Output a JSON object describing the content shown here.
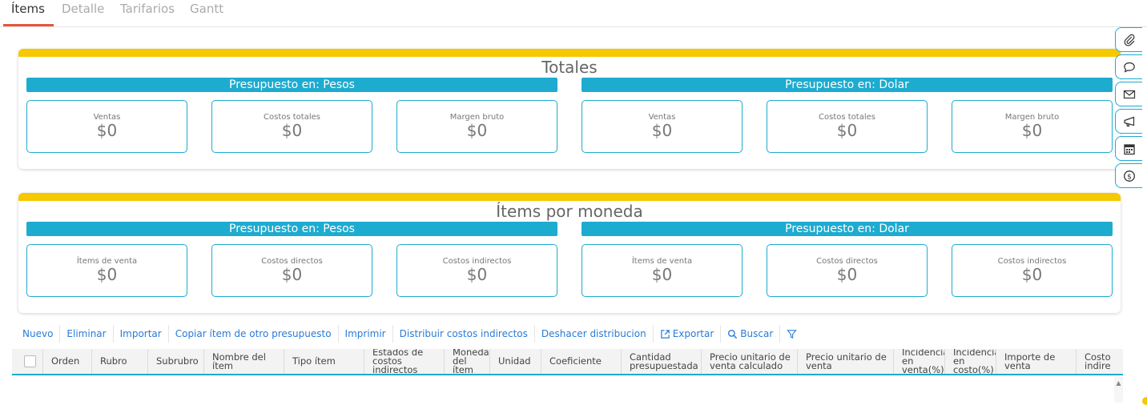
{
  "tabs": [
    "Ítems",
    "Detalle",
    "Tarifarios",
    "Gantt"
  ],
  "totales": {
    "title": "Totales",
    "groups": [
      {
        "header": "Presupuesto en: Pesos",
        "cards": [
          {
            "label": "Ventas",
            "value": "$0"
          },
          {
            "label": "Costos totales",
            "value": "$0"
          },
          {
            "label": "Margen bruto",
            "value": "$0"
          }
        ]
      },
      {
        "header": "Presupuesto en: Dolar",
        "cards": [
          {
            "label": "Ventas",
            "value": "$0"
          },
          {
            "label": "Costos totales",
            "value": "$0"
          },
          {
            "label": "Margen bruto",
            "value": "$0"
          }
        ]
      }
    ]
  },
  "items_por_moneda": {
    "title": "Ítems por moneda",
    "groups": [
      {
        "header": "Presupuesto en: Pesos",
        "cards": [
          {
            "label": "Ítems de venta",
            "value": "$0"
          },
          {
            "label": "Costos directos",
            "value": "$0"
          },
          {
            "label": "Costos indirectos",
            "value": "$0"
          }
        ]
      },
      {
        "header": "Presupuesto en: Dolar",
        "cards": [
          {
            "label": "Ítems de venta",
            "value": "$0"
          },
          {
            "label": "Costos directos",
            "value": "$0"
          },
          {
            "label": "Costos indirectos",
            "value": "$0"
          }
        ]
      }
    ]
  },
  "toolbar": {
    "nuevo": "Nuevo",
    "eliminar": "Eliminar",
    "importar": "Importar",
    "copiar": "Copiar ítem de otro presupuesto",
    "imprimir": "Imprimir",
    "distribuir": "Distribuir costos indirectos",
    "deshacer": "Deshacer distribucion",
    "exportar": "Exportar",
    "buscar": "Buscar"
  },
  "grid": {
    "columns": [
      "Orden",
      "Rubro",
      "Subrubro",
      "Nombre del ítem",
      "Tipo ítem",
      "Estados de costos indirectos",
      "Moneda del ítem",
      "Unidad",
      "Coeficiente",
      "Cantidad presupuestada",
      "Precio unitario de venta calculado",
      "Precio unitario de venta",
      "Incidencia en venta(%)",
      "Incidencia en costo(%)",
      "Importe de venta",
      "Costo indire"
    ]
  },
  "rail_icons": [
    "paperclip-icon",
    "chat-icon",
    "mail-icon",
    "megaphone-icon",
    "calendar-icon",
    "dollar-icon"
  ],
  "colors": {
    "accent": "#1eabd0",
    "panel_top": "#f5c800",
    "tab_active": "#e6563a",
    "link": "#2a7bd6"
  }
}
